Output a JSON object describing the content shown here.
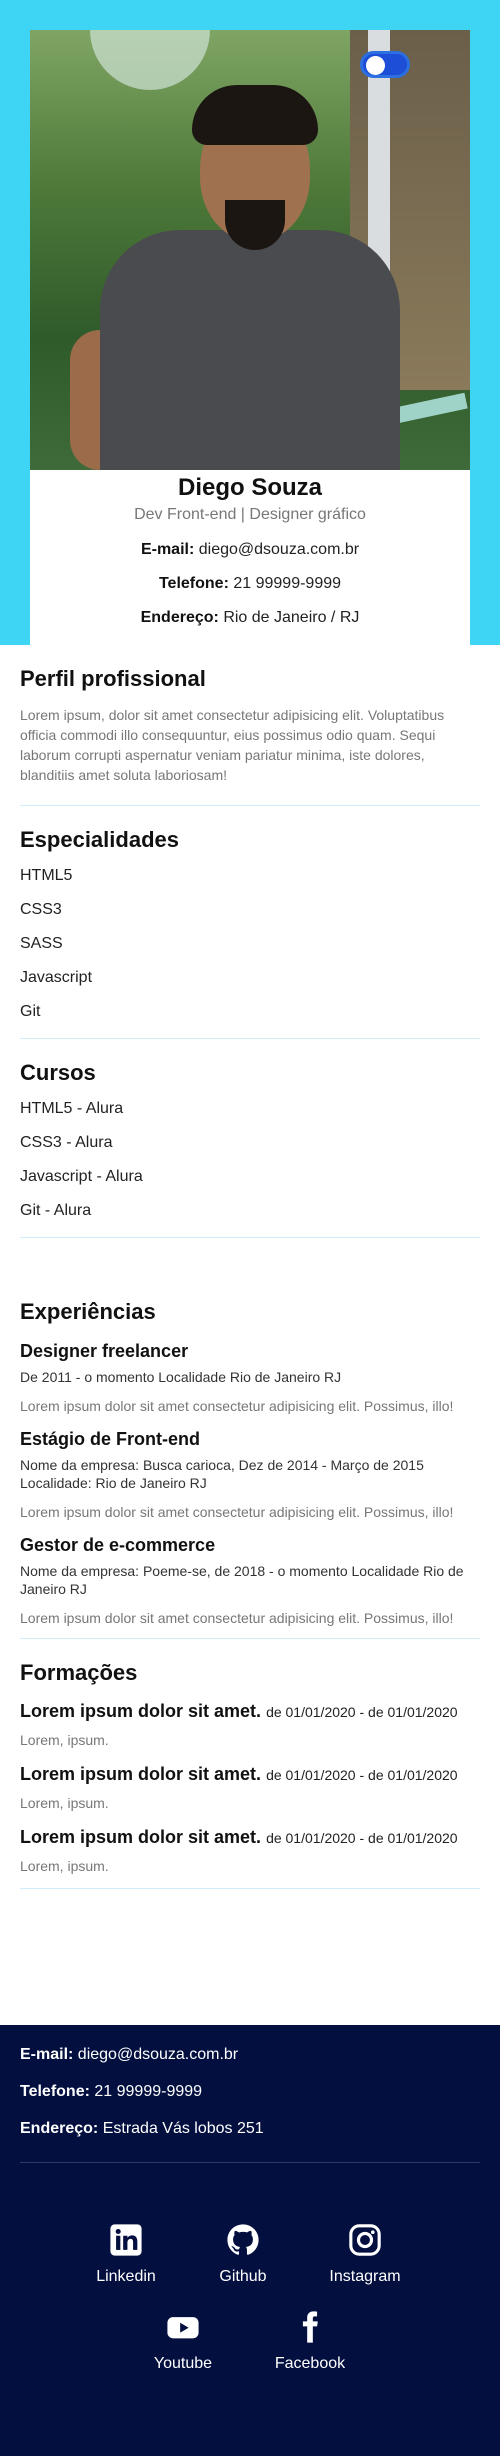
{
  "header": {
    "theme_toggle": "on",
    "name": "Diego Souza",
    "role": "Dev Front-end | Designer gráfico",
    "email_label": "E-mail:",
    "email": "diego@dsouza.com.br",
    "phone_label": "Telefone:",
    "phone": "21 99999-9999",
    "address_label": "Endereço:",
    "address": "Rio de Janeiro / RJ"
  },
  "profile": {
    "title": "Perfil profissional",
    "text": "Lorem ipsum, dolor sit amet consectetur adipisicing elit. Voluptatibus officia commodi illo consequuntur, eius possimus odio quam. Sequi laborum corrupti aspernatur veniam pariatur minima, iste dolores, blanditiis amet soluta laboriosam!"
  },
  "skills": {
    "title": "Especialidades",
    "items": [
      "HTML5",
      "CSS3",
      "SASS",
      "Javascript",
      "Git"
    ]
  },
  "courses": {
    "title": "Cursos",
    "items": [
      "HTML5 - Alura",
      "CSS3 - Alura",
      "Javascript - Alura",
      "Git - Alura"
    ]
  },
  "experience": {
    "title": "Experiências",
    "items": [
      {
        "role": "Designer freelancer",
        "meta": "De 2011 - o momento Localidade Rio de Janeiro RJ",
        "text": "Lorem ipsum dolor sit amet consectetur adipisicing elit. Possimus, illo!"
      },
      {
        "role": "Estágio de Front-end",
        "meta": "Nome da empresa: Busca carioca, Dez de 2014 - Março de 2015 Localidade: Rio de Janeiro RJ",
        "text": "Lorem ipsum dolor sit amet consectetur adipisicing elit. Possimus, illo!"
      },
      {
        "role": "Gestor de e-commerce",
        "meta": "Nome da empresa: Poeme-se, de 2018 - o momento Localidade Rio de Janeiro RJ",
        "text": "Lorem ipsum dolor sit amet consectetur adipisicing elit. Possimus, illo!"
      }
    ]
  },
  "education": {
    "title": "Formações",
    "items": [
      {
        "course": "Lorem ipsum dolor sit amet.",
        "dates": "de 01/01/2020 - de 01/01/2020",
        "text": "Lorem, ipsum."
      },
      {
        "course": "Lorem ipsum dolor sit amet.",
        "dates": "de 01/01/2020 - de 01/01/2020",
        "text": "Lorem, ipsum."
      },
      {
        "course": "Lorem ipsum dolor sit amet.",
        "dates": "de 01/01/2020 - de 01/01/2020",
        "text": "Lorem, ipsum."
      }
    ]
  },
  "footer": {
    "email_label": "E-mail:",
    "email": "diego@dsouza.com.br",
    "phone_label": "Telefone:",
    "phone": "21 99999-9999",
    "address_label": "Endereço:",
    "address": "Estrada Vás lobos 251",
    "social": {
      "linkedin": "Linkedin",
      "github": "Github",
      "instagram": "Instagram",
      "youtube": "Youtube",
      "facebook": "Facebook"
    }
  },
  "colors": {
    "hero_bg": "#3dd5f3",
    "footer_bg": "#020f3f",
    "toggle": "#1d4ed8",
    "divider": "#cfeefa"
  }
}
